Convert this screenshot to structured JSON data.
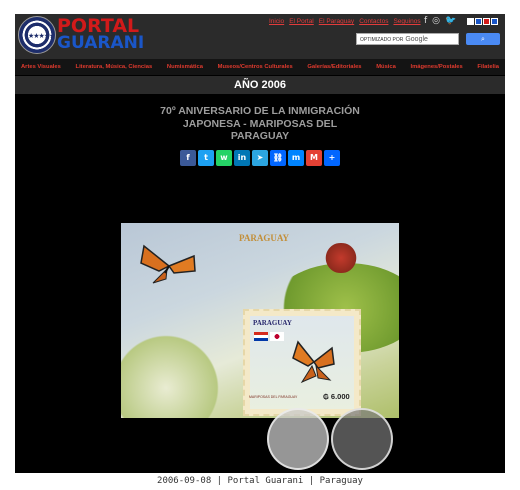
{
  "header": {
    "logo_top": "PORTAL",
    "logo_bottom": "GUARANI",
    "top_links": [
      "Inicio",
      "El Portal",
      "El Paraguay",
      "Contactos",
      "Seguinos"
    ],
    "social_icons": [
      "facebook-icon",
      "instagram-icon",
      "twitter-icon"
    ],
    "theme_swatches": [
      "#ffffff",
      "#1a56c8",
      "#d21a1a",
      "#1a56c8"
    ],
    "search": {
      "placeholder": "OPTIMIZADO POR",
      "brand": "Google",
      "button_icon": "search-icon"
    }
  },
  "nav": {
    "items": [
      "Artes Visuales",
      "Literatura, Música, Ciencias",
      "Numismática",
      "Museos/Centros Culturales",
      "Galerías/Editoriales",
      "Música",
      "Imágenes/Postales",
      "Filatelia"
    ]
  },
  "year_bar": "AÑO 2006",
  "article": {
    "title_lines": [
      "70º ANIVERSARIO DE LA INMIGRACIÓN",
      "JAPONESA - MARIPOSAS DEL",
      "PARAGUAY"
    ]
  },
  "share_buttons": [
    {
      "name": "facebook",
      "glyph": "f",
      "color": "#3b5998"
    },
    {
      "name": "twitter",
      "glyph": "t",
      "color": "#1da1f2"
    },
    {
      "name": "whatsapp",
      "glyph": "w",
      "color": "#25d366"
    },
    {
      "name": "linkedin",
      "glyph": "in",
      "color": "#0077b5"
    },
    {
      "name": "telegram",
      "glyph": "➤",
      "color": "#2ca5e0"
    },
    {
      "name": "copy-link",
      "glyph": "⛓",
      "color": "#0166ff"
    },
    {
      "name": "messenger",
      "glyph": "m",
      "color": "#0084ff"
    },
    {
      "name": "gmail",
      "glyph": "M",
      "color": "#e44134"
    },
    {
      "name": "share",
      "glyph": "+",
      "color": "#0166ff"
    }
  ],
  "stamp_sheet": {
    "sheet_title": "PARAGUAY",
    "stamp_title": "PARAGUAY",
    "stamp_value": "₲ 6.000",
    "stamp_caption": "MARIPOSAS DEL PARAGUAY"
  },
  "caption": "2006-09-08 | Portal Guarani | Paraguay"
}
